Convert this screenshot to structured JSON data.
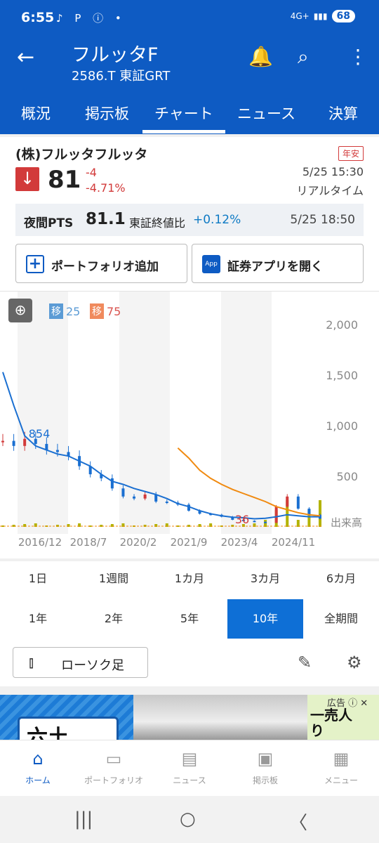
{
  "status": {
    "time": "6:55",
    "net": "4G+",
    "battery": "68"
  },
  "header": {
    "title": "フルッタF",
    "subtitle": "2586.T 東証GRT"
  },
  "tabs": [
    "概況",
    "掲示板",
    "チャート",
    "ニュース",
    "決算"
  ],
  "stock": {
    "name": "(株)フルッタフルッタ",
    "badge": "年安",
    "price": "81",
    "change": "-4",
    "change_pct": "-4.71%",
    "time": "5/25 15:30",
    "realtime": "リアルタイム"
  },
  "pts": {
    "label": "夜間PTS",
    "price": "81.1",
    "compare_label": "東証終値比",
    "compare_value": "+0.12%",
    "time": "5/25 18:50"
  },
  "actions": {
    "portfolio": "ポートフォリオ追加",
    "app": "証券アプリを開く",
    "app_icon_text": "App"
  },
  "moving_avgs": [
    {
      "tag": "移",
      "value": "25",
      "color": "#5b9bd5"
    },
    {
      "tag": "移",
      "value": "75",
      "color": "#f08a5d"
    }
  ],
  "chart_data": {
    "type": "line",
    "y_ticks": [
      "2,000",
      "1,500",
      "1,000",
      "500"
    ],
    "volume_label": "出来高",
    "x_ticks": [
      "2016/12",
      "2018/7",
      "2020/2",
      "2021/9",
      "2023/4",
      "2024/11"
    ],
    "ylim": [
      0,
      2000
    ],
    "annotations": [
      {
        "label": "854",
        "value": 854
      },
      {
        "label": "36",
        "value": 36
      }
    ],
    "series": [
      {
        "values": [
          1530,
          1200,
          900,
          800,
          760,
          720,
          700,
          650,
          600,
          520,
          450,
          420,
          380,
          350,
          320,
          280,
          230,
          200,
          160,
          130,
          110,
          95,
          90,
          80,
          85,
          100,
          120,
          110,
          100,
          100
        ]
      },
      {
        "values": [
          null,
          null,
          null,
          null,
          null,
          null,
          null,
          null,
          null,
          null,
          null,
          null,
          null,
          null,
          null,
          null,
          780,
          680,
          560,
          480,
          420,
          370,
          330,
          290,
          250,
          200,
          170,
          140,
          120,
          110
        ]
      }
    ],
    "price": [
      850,
      800,
      870,
      820,
      760,
      740,
      700,
      600,
      520,
      480,
      380,
      300,
      280,
      320,
      250,
      240,
      220,
      160,
      130,
      120,
      100,
      70,
      60,
      50,
      40,
      200,
      300,
      180,
      120,
      81
    ]
  },
  "ranges_row1": [
    "1日",
    "1週間",
    "1カ月",
    "3カ月",
    "6カ月"
  ],
  "ranges_row2": [
    "1年",
    "2年",
    "5年",
    "10年",
    "全期間"
  ],
  "range_active": "10年",
  "chart_type": "ローソク足",
  "ad": {
    "label": "広告",
    "side_text": "一売人り",
    "box_text": "六土"
  },
  "bottom_nav": [
    "ホーム",
    "ポートフォリオ",
    "ニュース",
    "掲示板",
    "メニュー"
  ]
}
